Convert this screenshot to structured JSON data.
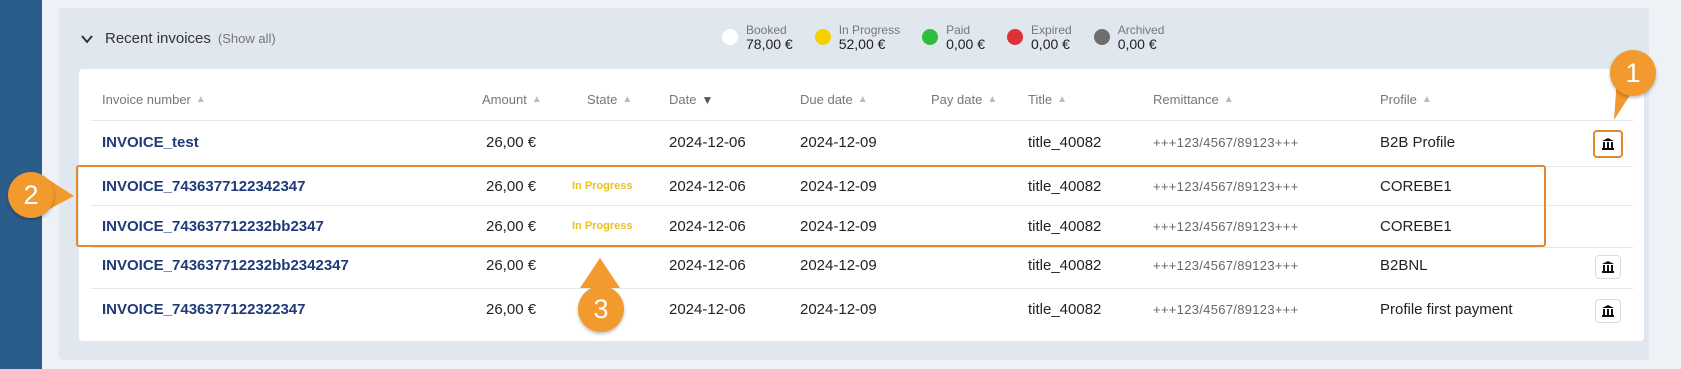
{
  "section": {
    "title": "Recent invoices",
    "show_all": "(Show all)"
  },
  "legend": [
    {
      "label": "Booked",
      "value": "78,00 €",
      "color": "#ffffff"
    },
    {
      "label": "In Progress",
      "value": "52,00 €",
      "color": "#f5d000"
    },
    {
      "label": "Paid",
      "value": "0,00 €",
      "color": "#2dbe3c"
    },
    {
      "label": "Expired",
      "value": "0,00 €",
      "color": "#e0303a"
    },
    {
      "label": "Archived",
      "value": "0,00 €",
      "color": "#6e6e6e"
    }
  ],
  "columns": [
    "Invoice number",
    "Amount",
    "State",
    "Date",
    "Due date",
    "Pay date",
    "Title",
    "Remittance",
    "Profile"
  ],
  "sort": {
    "active_column": "Date",
    "direction": "descending"
  },
  "rows": [
    {
      "invoice": "INVOICE_test",
      "amount": "26,00 €",
      "state": "",
      "date": "2024-12-06",
      "due_date": "2024-12-09",
      "pay_date": "",
      "title": "title_40082",
      "remittance": "+++123/4567/89123+++",
      "profile": "B2B Profile",
      "bank_action": true
    },
    {
      "invoice": "INVOICE_7436377122342347",
      "amount": "26,00 €",
      "state": "In Progress",
      "date": "2024-12-06",
      "due_date": "2024-12-09",
      "pay_date": "",
      "title": "title_40082",
      "remittance": "+++123/4567/89123+++",
      "profile": "COREBE1",
      "bank_action": false
    },
    {
      "invoice": "INVOICE_743637712232bb2347",
      "amount": "26,00 €",
      "state": "In Progress",
      "date": "2024-12-06",
      "due_date": "2024-12-09",
      "pay_date": "",
      "title": "title_40082",
      "remittance": "+++123/4567/89123+++",
      "profile": "COREBE1",
      "bank_action": false
    },
    {
      "invoice": "INVOICE_743637712232bb2342347",
      "amount": "26,00 €",
      "state": "",
      "date": "2024-12-06",
      "due_date": "2024-12-09",
      "pay_date": "",
      "title": "title_40082",
      "remittance": "+++123/4567/89123+++",
      "profile": "B2BNL",
      "bank_action": true
    },
    {
      "invoice": "INVOICE_7436377122322347",
      "amount": "26,00 €",
      "state": "",
      "date": "2024-12-06",
      "due_date": "2024-12-09",
      "pay_date": "",
      "title": "title_40082",
      "remittance": "+++123/4567/89123+++",
      "profile": "Profile first payment",
      "bank_action": true
    }
  ],
  "callouts": [
    "1",
    "2",
    "3"
  ],
  "colors": {
    "accent": "#e4892a",
    "callout": "#f29a2e",
    "link": "#1f3a7a",
    "state_in_progress": "#e7c21a"
  }
}
